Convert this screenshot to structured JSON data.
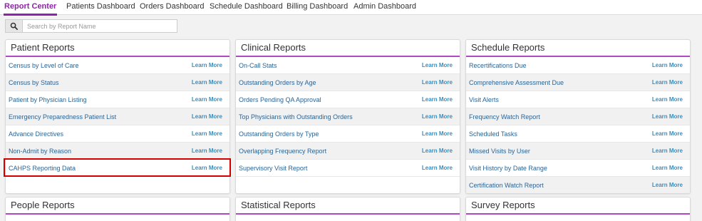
{
  "nav": {
    "tabs": [
      {
        "label": "Report Center"
      },
      {
        "label": "Patients Dashboard"
      },
      {
        "label": "Orders Dashboard"
      },
      {
        "label": "Schedule Dashboard"
      },
      {
        "label": "Billing Dashboard"
      },
      {
        "label": "Admin Dashboard"
      }
    ]
  },
  "search": {
    "placeholder": "Search by Report Name"
  },
  "learn_more": "Learn More",
  "panels": {
    "patient": {
      "title": "Patient Reports",
      "items": [
        "Census by Level of Care",
        "Census by Status",
        "Patient by Physician Listing",
        "Emergency Preparedness Patient List",
        "Advance Directives",
        "Non-Admit by Reason",
        "CAHPS Reporting Data"
      ]
    },
    "clinical": {
      "title": "Clinical Reports",
      "items": [
        "On-Call Stats",
        "Outstanding Orders by Age",
        "Orders Pending QA Approval",
        "Top Physicians with Outstanding Orders",
        "Outstanding Orders by Type",
        "Overlapping Frequency Report",
        "Supervisory Visit Report"
      ]
    },
    "schedule": {
      "title": "Schedule Reports",
      "items": [
        "Recertifications Due",
        "Comprehensive Assessment Due",
        "Visit Alerts",
        "Frequency Watch Report",
        "Scheduled Tasks",
        "Missed Visits by User",
        "Visit History by Date Range",
        "Certification Watch Report"
      ]
    },
    "people": {
      "title": "People Reports"
    },
    "statistical": {
      "title": "Statistical Reports"
    },
    "survey": {
      "title": "Survey Reports"
    }
  },
  "colors": {
    "accent": "#8e24aa",
    "link": "#2a6496",
    "learn_more": "#3c8dbc",
    "highlight": "#d40000"
  }
}
